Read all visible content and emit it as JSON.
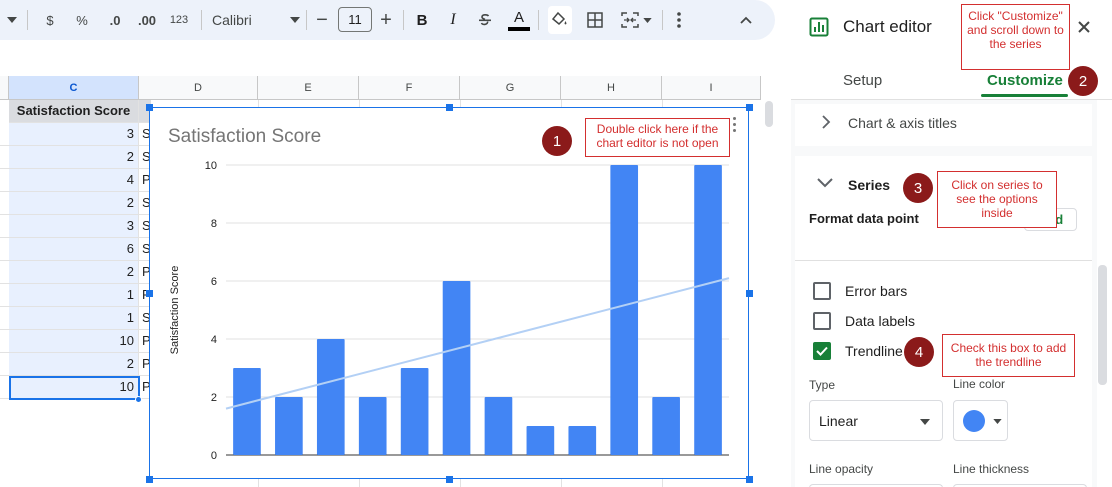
{
  "toolbar": {
    "currency_label": "$",
    "percent_label": "%",
    "decrease_decimal_label": ".0",
    "increase_decimal_label": ".00",
    "number_format_label": "123",
    "font_name": "Calibri",
    "font_size": "11",
    "minus_label": "−",
    "plus_label": "+",
    "bold_label": "B",
    "italic_label": "I",
    "underline_label": "A"
  },
  "grid": {
    "columns": [
      "C",
      "D",
      "E",
      "F",
      "G",
      "H",
      "I"
    ],
    "header_cell": "Satisfaction Score",
    "rows": [
      {
        "c": "3",
        "d": "S"
      },
      {
        "c": "2",
        "d": "S"
      },
      {
        "c": "4",
        "d": "P"
      },
      {
        "c": "2",
        "d": "S"
      },
      {
        "c": "3",
        "d": "S"
      },
      {
        "c": "6",
        "d": "S"
      },
      {
        "c": "2",
        "d": "P"
      },
      {
        "c": "1",
        "d": "P"
      },
      {
        "c": "1",
        "d": "S"
      },
      {
        "c": "10",
        "d": "P"
      },
      {
        "c": "2",
        "d": "P"
      },
      {
        "c": "10",
        "d": "P"
      }
    ]
  },
  "chart_data": {
    "type": "bar",
    "title": "Satisfaction Score",
    "ylabel": "Satisfaction Score",
    "xlabel": "",
    "ylim": [
      0,
      10
    ],
    "yticks": [
      "0",
      "2",
      "4",
      "6",
      "8",
      "10"
    ],
    "values": [
      3,
      2,
      4,
      2,
      3,
      6,
      2,
      1,
      1,
      10,
      2,
      10
    ],
    "trendline": {
      "type": "linear",
      "start": 1.6,
      "end": 6.1
    },
    "bar_color": "#4285f4",
    "trendline_color": "#b3d0f5",
    "grid": true
  },
  "callouts": [
    {
      "number": "1",
      "text": "Double click here if the chart editor is not open"
    },
    {
      "number": "2",
      "text": "Click \"Customize\" and scroll down to the series"
    },
    {
      "number": "3",
      "text": "Click on series to see the options inside"
    },
    {
      "number": "4",
      "text": "Check this box to add  the trendline"
    }
  ],
  "editor": {
    "title": "Chart editor",
    "tabs": {
      "setup": "Setup",
      "customize": "Customize"
    },
    "chart_axis_titles": "Chart & axis titles",
    "series": "Series",
    "format_data_point": "Format data point",
    "add_label": "Add",
    "error_bars": "Error bars",
    "data_labels": "Data labels",
    "trendline": "Trendline",
    "type_label": "Type",
    "type_value": "Linear",
    "line_color_label": "Line color",
    "line_color_value": "#4285f4",
    "line_opacity_label": "Line opacity",
    "line_thickness_label": "Line thickness",
    "checkbox_states": {
      "error_bars": false,
      "data_labels": false,
      "trendline": true
    }
  },
  "colors": {
    "accent_green": "#188038",
    "selection_blue": "#1a73e8",
    "callout_red": "#d32f2f",
    "callout_badge": "#8b1a1a"
  }
}
